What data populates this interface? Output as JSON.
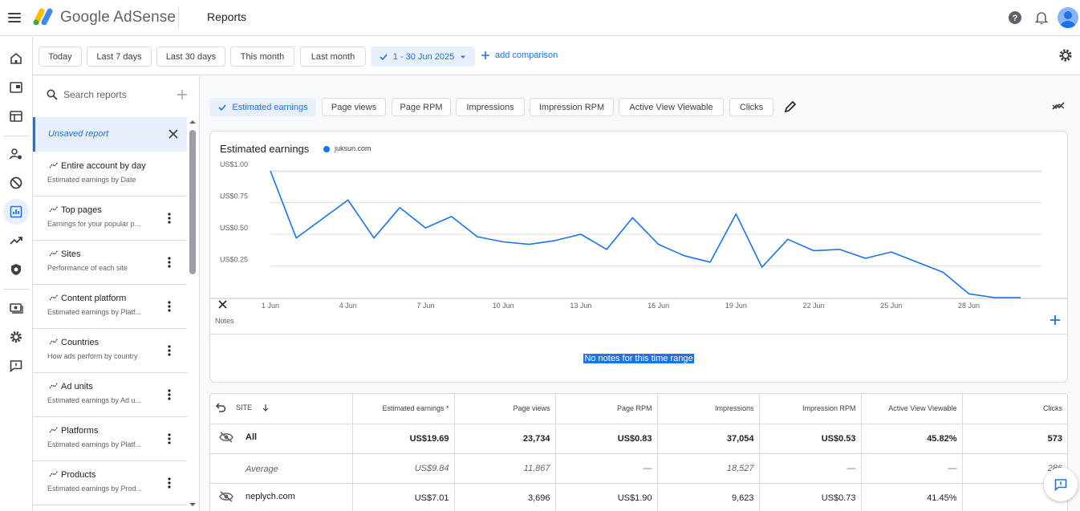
{
  "app": {
    "brand": "Google AdSense",
    "page_title": "Reports"
  },
  "icons": {
    "menu": "menu-icon",
    "help": "help-icon",
    "bell": "notifications-icon",
    "avatar": "account-avatar",
    "rail": [
      "home-icon",
      "sites-icon",
      "ads-icon",
      "privacy-icon",
      "blocking-icon",
      "reports-icon",
      "optimization-icon",
      "policy-center-icon",
      "payments-icon",
      "settings-icon",
      "feedback-icon"
    ]
  },
  "colors": {
    "accent": "#1a73e8",
    "selected_bg": "#e8f0fe",
    "line": "#1a73e8"
  },
  "date_filters": {
    "chips": [
      "Today",
      "Last 7 days",
      "Last 30 days",
      "This month",
      "Last month"
    ],
    "selected_range": "1 - 30 Jun 2025",
    "add_comparison": "add comparison"
  },
  "sidebar": {
    "search_placeholder": "Search reports",
    "unsaved_report": "Unsaved report",
    "reports": [
      {
        "title": "Entire account by day",
        "subtitle": "Estimated earnings by Date",
        "has_menu": false
      },
      {
        "title": "Top pages",
        "subtitle": "Earnings for your popular p...",
        "has_menu": true
      },
      {
        "title": "Sites",
        "subtitle": "Performance of each site",
        "has_menu": true
      },
      {
        "title": "Content platform",
        "subtitle": "Estimated earnings by Platf...",
        "has_menu": true
      },
      {
        "title": "Countries",
        "subtitle": "How ads perform by country",
        "has_menu": true
      },
      {
        "title": "Ad units",
        "subtitle": "Estimated earnings by Ad u...",
        "has_menu": true
      },
      {
        "title": "Platforms",
        "subtitle": "Estimated earnings by Platf...",
        "has_menu": true
      },
      {
        "title": "Products",
        "subtitle": "Estimated earnings by Prod...",
        "has_menu": true
      }
    ]
  },
  "metrics": [
    "Estimated earnings",
    "Page views",
    "Page RPM",
    "Impressions",
    "Impression RPM",
    "Active View Viewable",
    "Clicks"
  ],
  "selected_metric": "Estimated earnings",
  "chart_data": {
    "type": "line",
    "title": "Estimated earnings",
    "series": [
      {
        "name": "juksun.com",
        "values": [
          1.0,
          0.47,
          0.62,
          0.77,
          0.47,
          0.71,
          0.55,
          0.64,
          0.48,
          0.44,
          0.42,
          0.45,
          0.5,
          0.38,
          0.63,
          0.42,
          0.33,
          0.28,
          0.66,
          0.24,
          0.46,
          0.37,
          0.38,
          0.31,
          0.36,
          0.28,
          0.2,
          0.03,
          0.0,
          0.0
        ]
      }
    ],
    "x": [
      "1 Jun",
      "2 Jun",
      "3 Jun",
      "4 Jun",
      "5 Jun",
      "6 Jun",
      "7 Jun",
      "8 Jun",
      "9 Jun",
      "10 Jun",
      "11 Jun",
      "12 Jun",
      "13 Jun",
      "14 Jun",
      "15 Jun",
      "16 Jun",
      "17 Jun",
      "18 Jun",
      "19 Jun",
      "20 Jun",
      "21 Jun",
      "22 Jun",
      "23 Jun",
      "24 Jun",
      "25 Jun",
      "26 Jun",
      "27 Jun",
      "28 Jun",
      "29 Jun",
      "30 Jun"
    ],
    "x_tick_labels": [
      "1 Jun",
      "4 Jun",
      "7 Jun",
      "10 Jun",
      "13 Jun",
      "16 Jun",
      "19 Jun",
      "22 Jun",
      "25 Jun",
      "28 Jun"
    ],
    "y_ticks": [
      0.25,
      0.5,
      0.75,
      1.0
    ],
    "y_tick_labels": [
      "US$0.25",
      "US$0.50",
      "US$0.75",
      "US$1.00"
    ],
    "ylim": [
      0,
      1.12
    ],
    "grid": true
  },
  "notes": {
    "label": "Notes",
    "empty_text": "No notes for this time range"
  },
  "table": {
    "site_header": "SITE",
    "headers": [
      "Estimated earnings *",
      "Page views",
      "Page RPM",
      "Impressions",
      "Impression RPM",
      "Active View Viewable",
      "Clicks"
    ],
    "rows": [
      {
        "type": "total",
        "site": "All",
        "values": [
          "US$19.69",
          "23,734",
          "US$0.83",
          "37,054",
          "US$0.53",
          "45.82%",
          "573"
        ]
      },
      {
        "type": "avg",
        "site": "Average",
        "values": [
          "US$9.84",
          "11,867",
          "—",
          "18,527",
          "—",
          "—",
          "286"
        ]
      },
      {
        "type": "site",
        "site": "neplych.com",
        "values": [
          "US$7.01",
          "3,696",
          "US$1.90",
          "9,623",
          "US$0.73",
          "41.45%",
          "1"
        ]
      }
    ]
  }
}
